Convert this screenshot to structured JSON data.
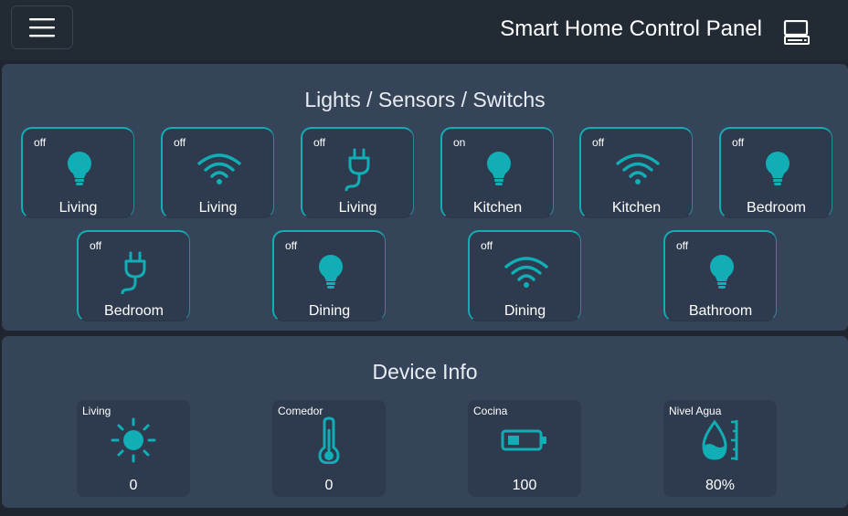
{
  "header": {
    "title": "Smart Home Control Panel",
    "menu_icon": "hamburger-menu-icon",
    "device_icon": "computer-monitor-icon"
  },
  "lights": {
    "title": "Lights / Sensors / Switchs",
    "accent_color": "#11aeb5",
    "tiles": [
      {
        "state": "off",
        "icon": "lightbulb-icon",
        "label": "Living"
      },
      {
        "state": "off",
        "icon": "wifi-icon",
        "label": "Living"
      },
      {
        "state": "off",
        "icon": "plug-icon",
        "label": "Living"
      },
      {
        "state": "on",
        "icon": "lightbulb-icon",
        "label": "Kitchen"
      },
      {
        "state": "off",
        "icon": "wifi-icon",
        "label": "Kitchen"
      },
      {
        "state": "off",
        "icon": "lightbulb-icon",
        "label": "Bedroom"
      },
      {
        "state": "off",
        "icon": "plug-icon",
        "label": "Bedroom"
      },
      {
        "state": "off",
        "icon": "lightbulb-icon",
        "label": "Dining"
      },
      {
        "state": "off",
        "icon": "wifi-icon",
        "label": "Dining"
      },
      {
        "state": "off",
        "icon": "lightbulb-icon",
        "label": "Bathroom"
      }
    ]
  },
  "device_info": {
    "title": "Device Info",
    "cards": [
      {
        "name": "Living",
        "icon": "sun-icon",
        "value": "0"
      },
      {
        "name": "Comedor",
        "icon": "thermometer-icon",
        "value": "0"
      },
      {
        "name": "Cocina",
        "icon": "battery-icon",
        "value": "100"
      },
      {
        "name": "Nivel Agua",
        "icon": "water-level-icon",
        "value": "80%"
      }
    ]
  }
}
